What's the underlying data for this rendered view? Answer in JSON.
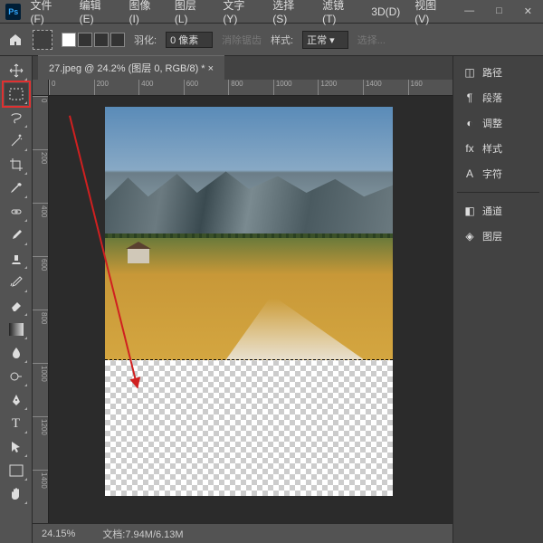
{
  "menu": {
    "file": "文件(F)",
    "edit": "编辑(E)",
    "image": "图像(I)",
    "layer": "图层(L)",
    "type": "文字(Y)",
    "select": "选择(S)",
    "filter": "滤镜(T)",
    "threed": "3D(D)",
    "view": "视图(V)"
  },
  "opt": {
    "feather_label": "羽化:",
    "feather_value": "0 像素",
    "antialias": "消除锯齿",
    "style_label": "样式:",
    "style_value": "正常",
    "refine": "选择..."
  },
  "tab": {
    "title": "27.jpeg @ 24.2% (图层 0, RGB/8) *"
  },
  "ruler_h": [
    "0",
    "200",
    "400",
    "600",
    "800",
    "1000",
    "1200",
    "1400",
    "160"
  ],
  "ruler_v": [
    "0",
    "200",
    "400",
    "600",
    "800",
    "1000",
    "1200",
    "1400"
  ],
  "status": {
    "zoom": "24.15%",
    "doc_label": "文档:",
    "doc_value": "7.94M/6.13M"
  },
  "panels": {
    "paths": "路径",
    "paragraph": "段落",
    "adjustments": "调整",
    "styles": "样式",
    "character": "字符",
    "channels": "通道",
    "layers": "图层"
  }
}
